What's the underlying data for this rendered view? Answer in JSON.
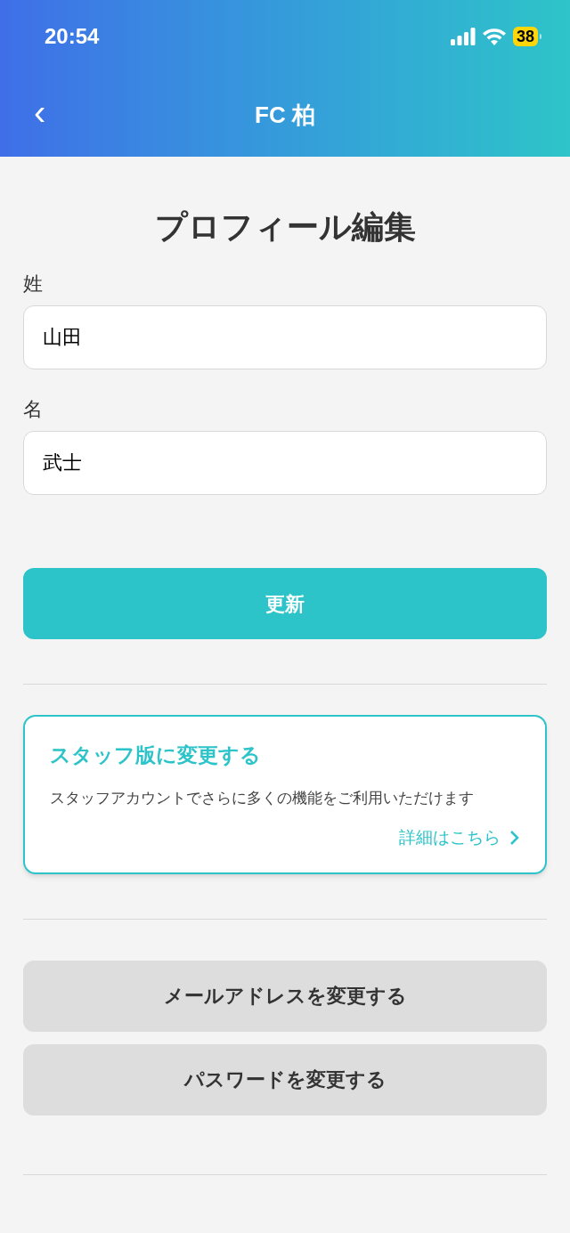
{
  "status_bar": {
    "time": "20:54",
    "battery": "38"
  },
  "header": {
    "title": "FC 柏",
    "back": "‹"
  },
  "page_title": "プロフィール編集",
  "fields": [
    {
      "label": "姓",
      "value": "山田"
    },
    {
      "label": "名",
      "value": "武士"
    }
  ],
  "submit_button": "更新",
  "staff_card": {
    "title": "スタッフ版に変更する",
    "description": "スタッフアカウントでさらに多くの機能をご利用いただけます",
    "link": "詳細はこちら"
  },
  "account_buttons": [
    "メールアドレスを変更する",
    "パスワードを変更する"
  ]
}
